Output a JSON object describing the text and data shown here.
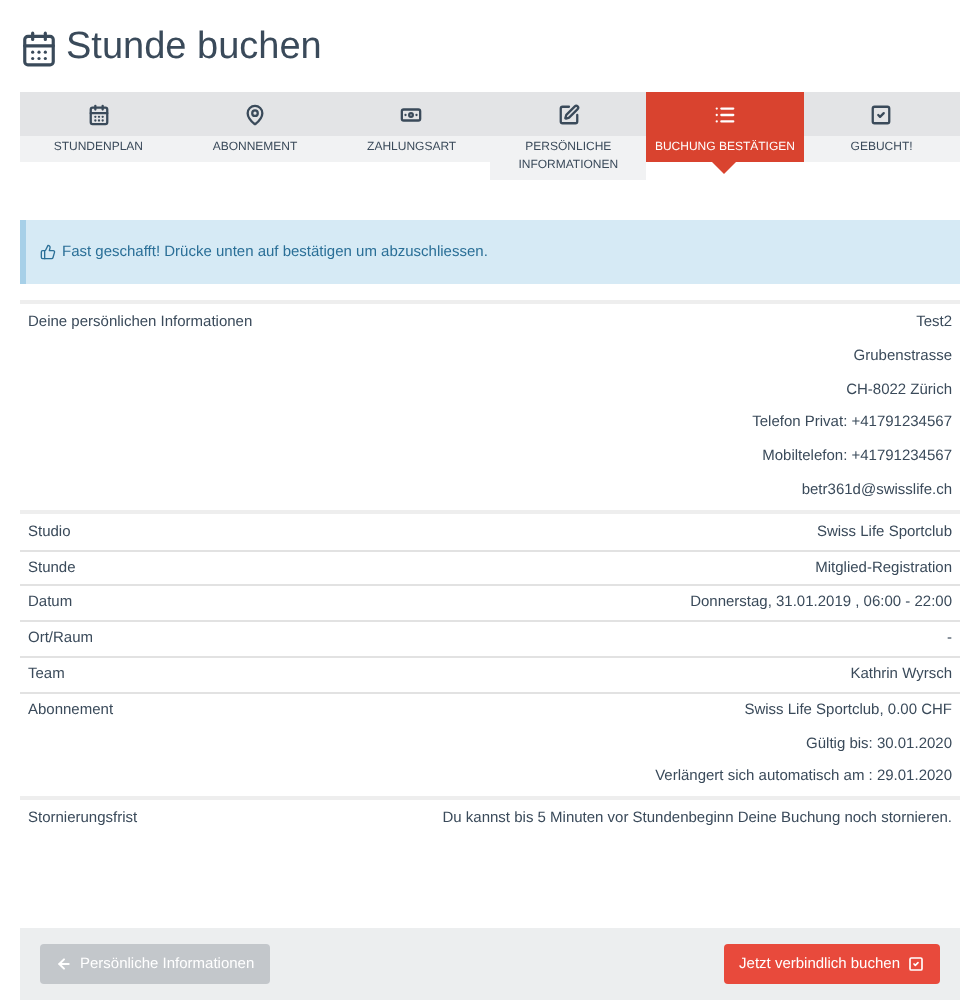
{
  "title": "Stunde buchen",
  "steps": [
    {
      "label": "STUNDENPLAN",
      "selected": false
    },
    {
      "label": "ABONNEMENT",
      "selected": false
    },
    {
      "label": "ZAHLUNGSART",
      "selected": false
    },
    {
      "label": "PERSÖNLICHE INFORMATIONEN",
      "selected": false
    },
    {
      "label": "BUCHUNG BESTÄTIGEN",
      "selected": true
    },
    {
      "label": "GEBUCHT!",
      "selected": false
    }
  ],
  "alert": "Fast geschafft! Drücke unten auf bestätigen um abzuschliessen.",
  "groups": [
    {
      "rows": [
        {
          "label": "Deine persönlichen Informationen",
          "values": [
            "Test2",
            "Grubenstrasse",
            "CH-8022 Zürich",
            "Telefon Privat: +41791234567",
            "Mobiltelefon: +41791234567",
            "betr361d@swisslife.ch"
          ]
        }
      ]
    },
    {
      "rows": [
        {
          "label": "Studio",
          "values": [
            "Swiss Life Sportclub"
          ]
        },
        {
          "label": "Stunde",
          "values": [
            "Mitglied-Registration"
          ]
        },
        {
          "label": "Datum",
          "values": [
            "Donnerstag, 31.01.2019 , 06:00 - 22:00"
          ]
        },
        {
          "label": "Ort/Raum",
          "values": [
            "-"
          ]
        },
        {
          "label": "Team",
          "values": [
            "Kathrin Wyrsch"
          ]
        },
        {
          "label": "Abonnement",
          "values": [
            "Swiss Life Sportclub, 0.00 CHF",
            "Gültig bis: 30.01.2020",
            "Verlängert sich automatisch am : 29.01.2020"
          ]
        }
      ]
    },
    {
      "rows": [
        {
          "label": "Stornierungsfrist",
          "values": [
            "Du kannst bis 5 Minuten vor Stundenbeginn Deine Buchung noch stornieren."
          ]
        }
      ]
    }
  ],
  "back_button": "Persönliche Informationen",
  "confirm_button": "Jetzt verbindlich buchen"
}
